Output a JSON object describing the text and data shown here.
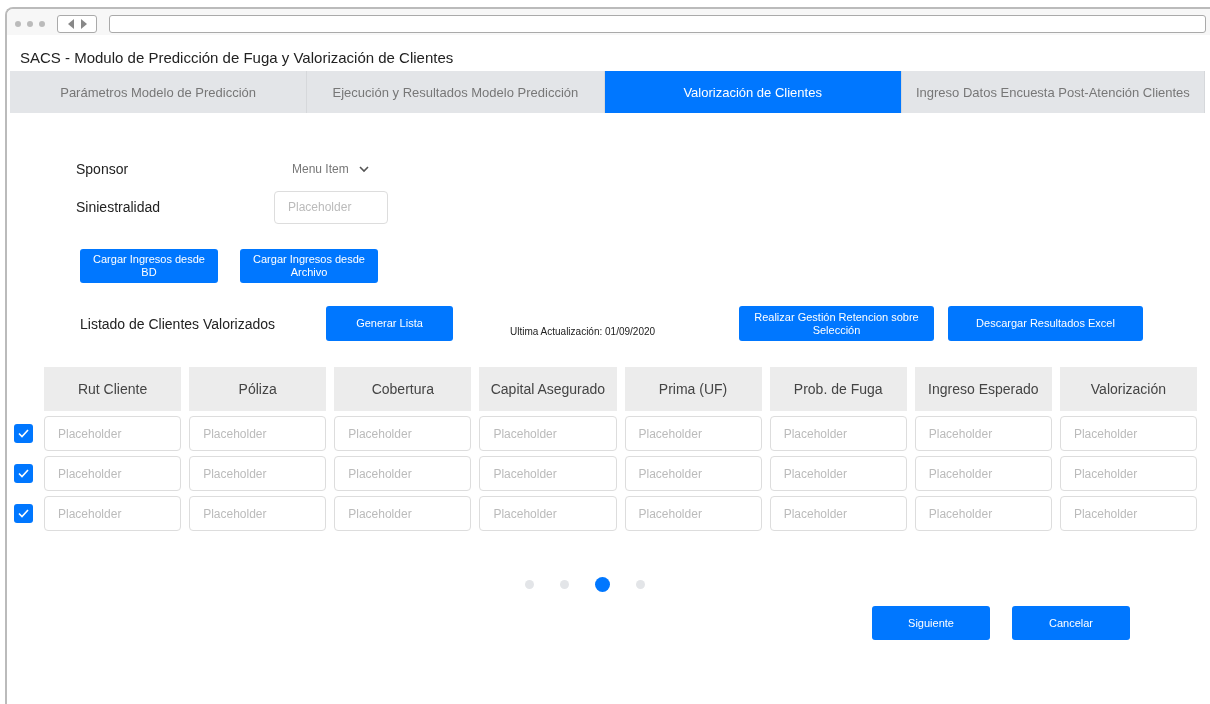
{
  "window": {
    "title": "SACS - Modulo de Predicción de Fuga y Valorización de Clientes"
  },
  "tabs": [
    {
      "label": "Parámetros Modelo de Predicción",
      "selected": false
    },
    {
      "label": "Ejecución y Resultados Modelo Predicción",
      "selected": false
    },
    {
      "label": "Valorización de Clientes",
      "selected": true
    },
    {
      "label": "Ingreso Datos Encuesta Post-Atención Clientes",
      "selected": false
    }
  ],
  "form": {
    "sponsor": {
      "label": "Sponsor",
      "value": "Menu Item"
    },
    "siniestralidad": {
      "label": "Siniestralidad",
      "placeholder": "Placeholder"
    }
  },
  "load_buttons": [
    "Cargar Ingresos desde BD",
    "Cargar Ingresos desde Archivo"
  ],
  "list": {
    "title": "Listado de Clientes Valorizados",
    "generate_button": "Generar Lista",
    "last_update": "Ultima Actualización: 01/09/2020",
    "actions": [
      "Realizar Gestión Retencion sobre Selección",
      "Descargar Resultados Excel"
    ]
  },
  "table": {
    "columns": [
      "Rut Cliente",
      "Póliza",
      "Cobertura",
      "Capital Asegurado",
      "Prima (UF)",
      "Prob. de Fuga",
      "Ingreso Esperado",
      "Valorización"
    ],
    "rows": [
      {
        "checked": true,
        "cells": [
          {
            "placeholder": "Placeholder"
          },
          {
            "placeholder": "Placeholder"
          },
          {
            "placeholder": "Placeholder"
          },
          {
            "placeholder": "Placeholder"
          },
          {
            "placeholder": "Placeholder"
          },
          {
            "placeholder": "Placeholder"
          },
          {
            "placeholder": "Placeholder"
          },
          {
            "placeholder": "Placeholder"
          }
        ]
      },
      {
        "checked": true,
        "cells": [
          {
            "placeholder": "Placeholder"
          },
          {
            "placeholder": "Placeholder"
          },
          {
            "placeholder": "Placeholder"
          },
          {
            "placeholder": "Placeholder"
          },
          {
            "placeholder": "Placeholder"
          },
          {
            "placeholder": "Placeholder"
          },
          {
            "placeholder": "Placeholder"
          },
          {
            "placeholder": "Placeholder"
          }
        ]
      },
      {
        "checked": true,
        "cells": [
          {
            "placeholder": "Placeholder"
          },
          {
            "placeholder": "Placeholder"
          },
          {
            "placeholder": "Placeholder"
          },
          {
            "placeholder": "Placeholder"
          },
          {
            "placeholder": "Placeholder"
          },
          {
            "placeholder": "Placeholder"
          },
          {
            "placeholder": "Placeholder"
          },
          {
            "placeholder": "Placeholder"
          }
        ]
      }
    ]
  },
  "pagination": [
    {
      "selected": false
    },
    {
      "selected": false
    },
    {
      "selected": true
    },
    {
      "selected": false
    }
  ],
  "buttons": [
    "Siguiente",
    "Cancelar"
  ]
}
